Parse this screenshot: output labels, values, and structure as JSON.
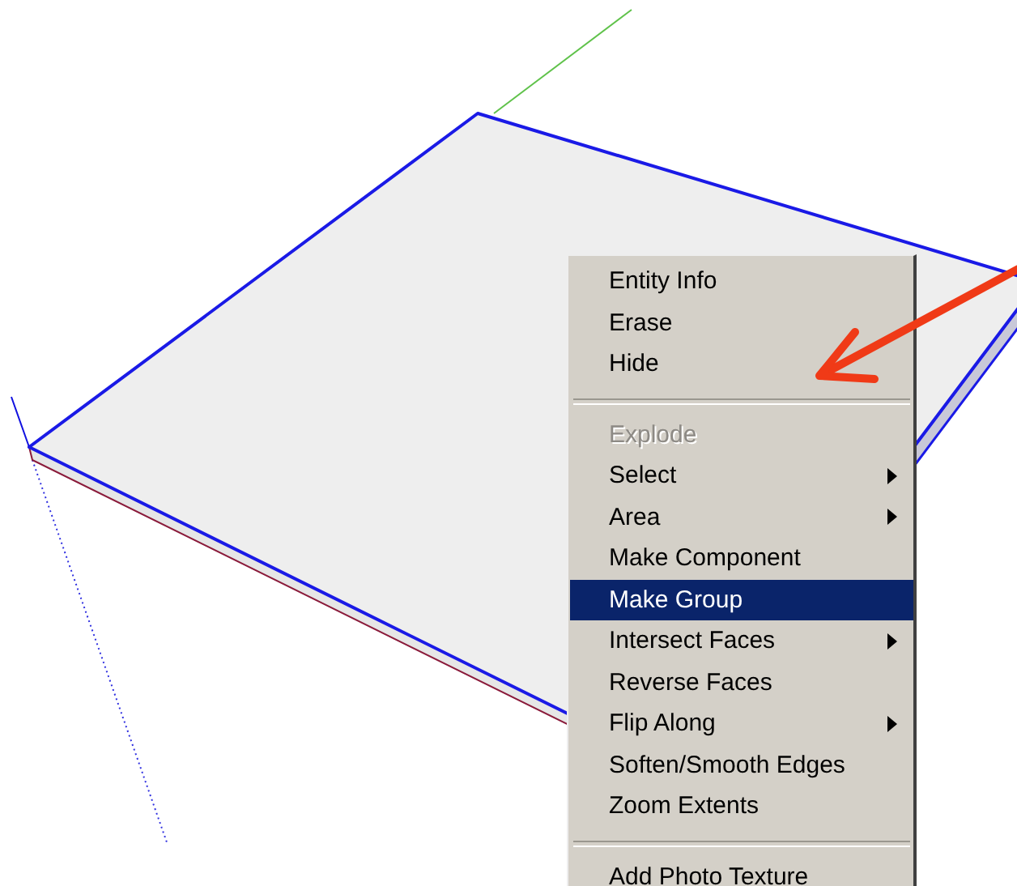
{
  "context_menu": {
    "items": [
      {
        "kind": "item",
        "label": "Entity Info",
        "disabled": false,
        "submenu": false,
        "selected": false
      },
      {
        "kind": "item",
        "label": "Erase",
        "disabled": false,
        "submenu": false,
        "selected": false
      },
      {
        "kind": "item",
        "label": "Hide",
        "disabled": false,
        "submenu": false,
        "selected": false
      },
      {
        "kind": "separator"
      },
      {
        "kind": "item",
        "label": "Explode",
        "disabled": true,
        "submenu": false,
        "selected": false
      },
      {
        "kind": "item",
        "label": "Select",
        "disabled": false,
        "submenu": true,
        "selected": false
      },
      {
        "kind": "item",
        "label": "Area",
        "disabled": false,
        "submenu": true,
        "selected": false
      },
      {
        "kind": "item",
        "label": "Make Component",
        "disabled": false,
        "submenu": false,
        "selected": false
      },
      {
        "kind": "item",
        "label": "Make Group",
        "disabled": false,
        "submenu": false,
        "selected": true
      },
      {
        "kind": "item",
        "label": "Intersect Faces",
        "disabled": false,
        "submenu": true,
        "selected": false
      },
      {
        "kind": "item",
        "label": "Reverse Faces",
        "disabled": false,
        "submenu": false,
        "selected": false
      },
      {
        "kind": "item",
        "label": "Flip Along",
        "disabled": false,
        "submenu": true,
        "selected": false
      },
      {
        "kind": "item",
        "label": "Soften/Smooth Edges",
        "disabled": false,
        "submenu": false,
        "selected": false
      },
      {
        "kind": "item",
        "label": "Zoom Extents",
        "disabled": false,
        "submenu": false,
        "selected": false
      },
      {
        "kind": "separator"
      },
      {
        "kind": "item",
        "label": "Add Photo Texture",
        "disabled": false,
        "submenu": false,
        "selected": false
      }
    ]
  }
}
